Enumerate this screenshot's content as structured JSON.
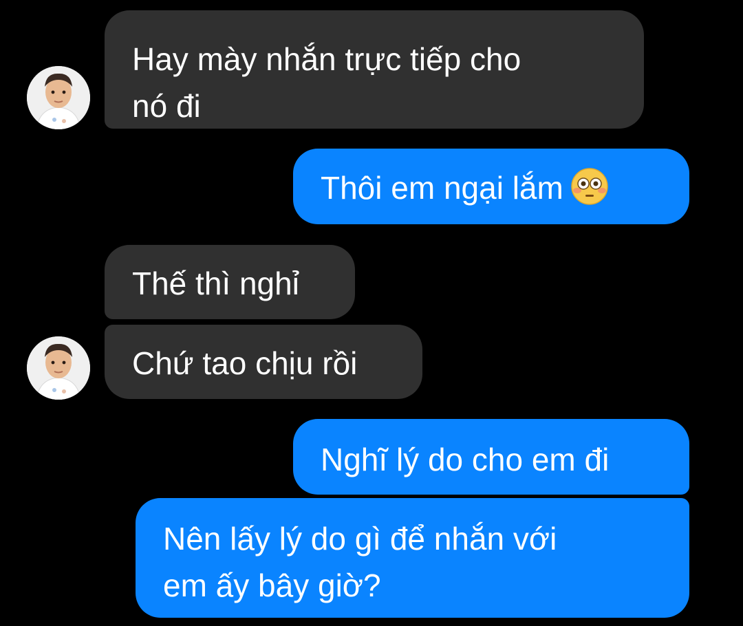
{
  "chat": {
    "messages": [
      {
        "sender": "other",
        "lines": [
          "Hay mày nhắn trực tiếp cho",
          "nó đi"
        ]
      },
      {
        "sender": "me",
        "text": "Thôi em ngại lắm",
        "emoji": "flushed-face-icon"
      },
      {
        "sender": "other",
        "text": "Thế thì nghỉ"
      },
      {
        "sender": "other",
        "text": "Chứ tao chịu rồi"
      },
      {
        "sender": "me",
        "text": "Nghĩ lý do cho em đi"
      },
      {
        "sender": "me",
        "lines": [
          "Nên lấy lý do gì để nhắn với",
          "em ấy bây giờ?"
        ]
      }
    ]
  },
  "colors": {
    "background": "#000000",
    "incoming_bubble": "#303030",
    "outgoing_bubble": "#0a84ff",
    "text": "#ffffff"
  },
  "avatar": {
    "icon": "child-avatar-icon"
  }
}
